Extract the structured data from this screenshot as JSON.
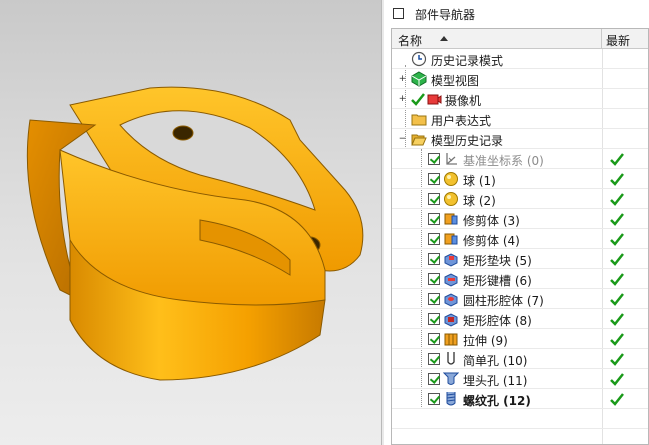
{
  "navigator": {
    "title": "部件导航器",
    "columns": {
      "name": "名称",
      "latest": "最新"
    },
    "rows": [
      {
        "label": "历史记录模式",
        "icon": "clock-icon"
      },
      {
        "label": "模型视图",
        "icon": "model-views-icon"
      },
      {
        "label": "摄像机",
        "icon": "camera-icon"
      },
      {
        "label": "用户表达式",
        "icon": "folder-icon"
      },
      {
        "label": "模型历史记录",
        "icon": "folder-open-icon"
      },
      {
        "label": "基准坐标系 (0)",
        "icon": "datum-csys-icon",
        "latest": true
      },
      {
        "label": "球 (1)",
        "icon": "sphere-icon",
        "latest": true
      },
      {
        "label": "球 (2)",
        "icon": "sphere-icon",
        "latest": true
      },
      {
        "label": "修剪体 (3)",
        "icon": "trim-body-icon",
        "latest": true
      },
      {
        "label": "修剪体 (4)",
        "icon": "trim-body-icon",
        "latest": true
      },
      {
        "label": "矩形垫块 (5)",
        "icon": "rect-pad-icon",
        "latest": true
      },
      {
        "label": "矩形键槽 (6)",
        "icon": "rect-slot-icon",
        "latest": true
      },
      {
        "label": "圆柱形腔体 (7)",
        "icon": "cyl-pocket-icon",
        "latest": true
      },
      {
        "label": "矩形腔体 (8)",
        "icon": "rect-pocket-icon",
        "latest": true
      },
      {
        "label": "拉伸 (9)",
        "icon": "extrude-icon",
        "latest": true
      },
      {
        "label": "简单孔 (10)",
        "icon": "simple-hole-icon",
        "latest": true
      },
      {
        "label": "埋头孔 (11)",
        "icon": "countersunk-hole-icon",
        "latest": true
      },
      {
        "label": "螺纹孔 (12)",
        "icon": "threaded-hole-icon",
        "latest": true
      }
    ]
  },
  "colors": {
    "part": "#f5a800",
    "part_shade": "#c98200",
    "check": "#1a9a1a"
  }
}
